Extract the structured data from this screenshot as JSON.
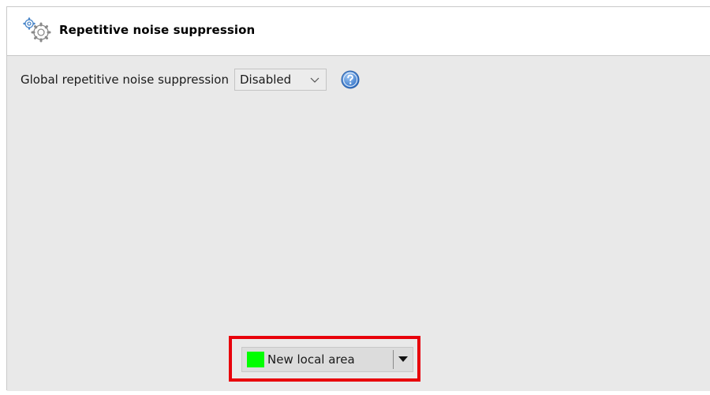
{
  "header": {
    "icon": "gears-icon",
    "title": "Repetitive noise suppression"
  },
  "global": {
    "label": "Global repetitive noise suppression",
    "select_value": "Disabled",
    "help_icon": "help-icon"
  },
  "local_area": {
    "label": "New local area",
    "color": "#00ff00",
    "highlight_color": "#e8000b"
  }
}
